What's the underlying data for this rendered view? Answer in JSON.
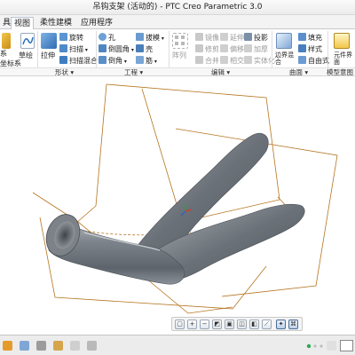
{
  "window": {
    "title": "吊钩支架 (活动的) - PTC Creo Parametric 3.0"
  },
  "tabs": [
    {
      "label": "具"
    },
    {
      "label": "视图"
    },
    {
      "label": "柔性建模"
    },
    {
      "label": "应用程序"
    }
  ],
  "ribbon": {
    "left_items": [
      "系",
      "坐标系",
      "草绘",
      "拉伸"
    ],
    "shape_items": [
      "旋转",
      "扫描",
      "扫描混合"
    ],
    "engineering_items": [
      "孔",
      "倒圆角",
      "倒角",
      "拔模",
      "壳",
      "筋"
    ],
    "editing_items": [
      "镜像",
      "延伸",
      "投影",
      "修剪",
      "偏移",
      "加厚",
      "合并",
      "相交",
      "实体化",
      "阵列"
    ],
    "surface_items": [
      "边界混合",
      "填充",
      "样式",
      "自由式"
    ],
    "model_intent_items": [
      "元件界面"
    ]
  },
  "group_labels": {
    "shape": "形状 ▾",
    "engineering": "工程 ▾",
    "editing": "编辑 ▾",
    "surface": "曲面 ▾",
    "model_intent": "模型意图"
  },
  "viewport": {
    "part": "hook-bracket",
    "frame_color": "#b5741f",
    "model_color": "#6e7379",
    "background_color": "#ffffff"
  },
  "view_toolbar": {
    "tools": [
      "refit",
      "zoom-in",
      "zoom-out",
      "repaint",
      "view-manager",
      "saved-views",
      "display-style",
      "datum-display",
      "spin-center",
      "annotation-display"
    ]
  },
  "statusbar": {
    "indicator_color": "#2fa84f"
  }
}
